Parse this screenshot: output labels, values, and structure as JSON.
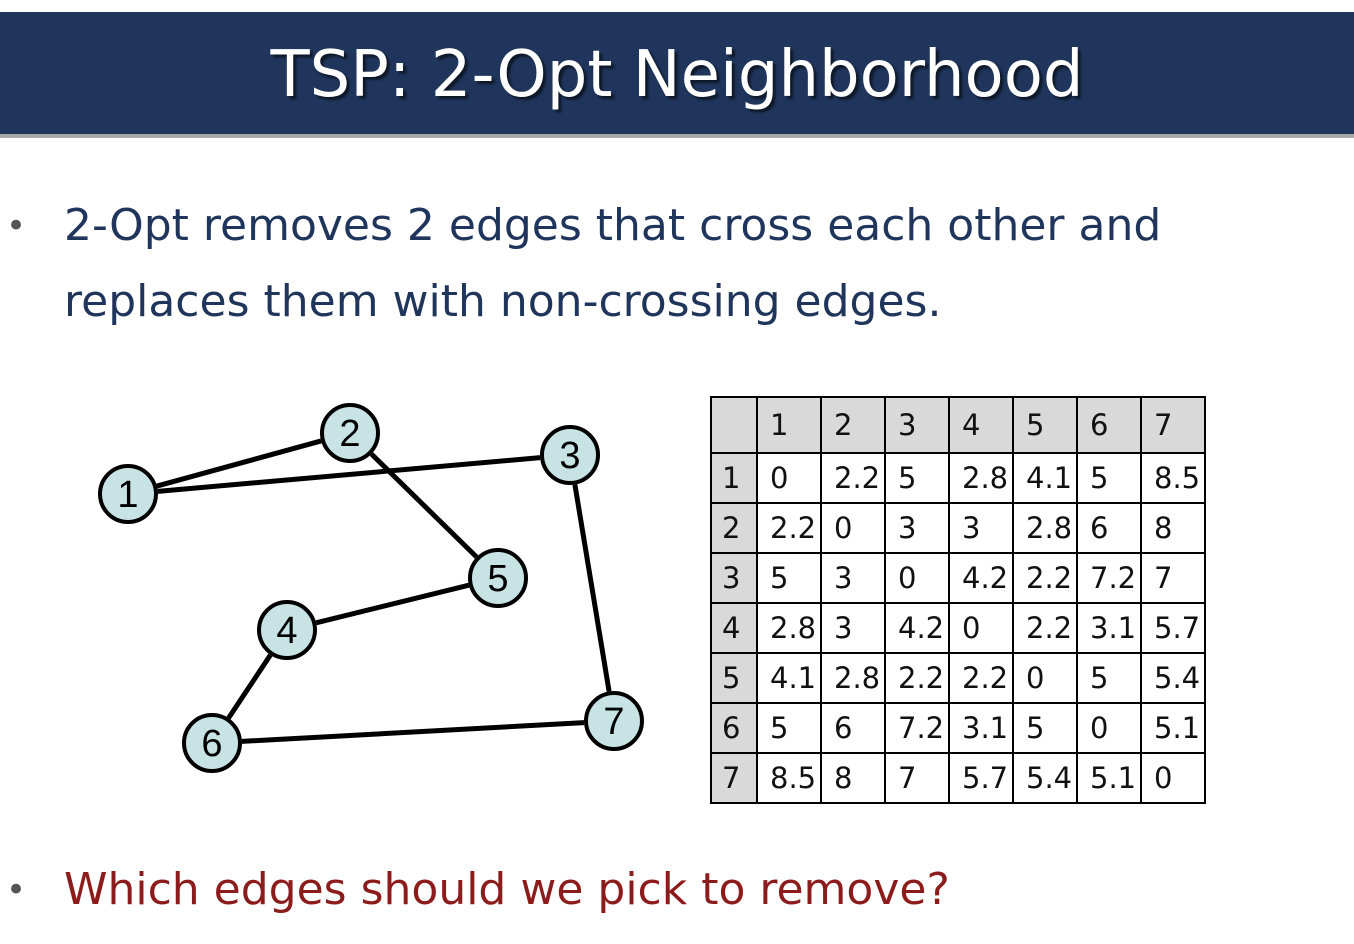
{
  "slide": {
    "title": "TSP: 2-Opt Neighborhood",
    "bullets": [
      {
        "symbol": "•",
        "lines": [
          "2-Opt removes 2 edges that cross each other and",
          "replaces them with non-crossing edges."
        ],
        "color": "#1f355b"
      },
      {
        "symbol": "•",
        "lines": [
          "Which edges should we pick to remove?"
        ],
        "color": "#8c1c1c"
      }
    ]
  },
  "graph": {
    "node_fill": "#c8e3e4",
    "nodes": [
      {
        "label": "1"
      },
      {
        "label": "2"
      },
      {
        "label": "3"
      },
      {
        "label": "4"
      },
      {
        "label": "5"
      },
      {
        "label": "6"
      },
      {
        "label": "7"
      }
    ],
    "edges": [
      [
        "1",
        "2"
      ],
      [
        "1",
        "3"
      ],
      [
        "2",
        "5"
      ],
      [
        "5",
        "4"
      ],
      [
        "4",
        "6"
      ],
      [
        "6",
        "7"
      ],
      [
        "3",
        "7"
      ]
    ]
  },
  "distance_table": {
    "columns": [
      "1",
      "2",
      "3",
      "4",
      "5",
      "6",
      "7"
    ],
    "rows": [
      {
        "label": "1",
        "values": [
          "0",
          "2.2",
          "5",
          "2.8",
          "4.1",
          "5",
          "8.5"
        ]
      },
      {
        "label": "2",
        "values": [
          "2.2",
          "0",
          "3",
          "3",
          "2.8",
          "6",
          "8"
        ]
      },
      {
        "label": "3",
        "values": [
          "5",
          "3",
          "0",
          "4.2",
          "2.2",
          "7.2",
          "7"
        ]
      },
      {
        "label": "4",
        "values": [
          "2.8",
          "3",
          "4.2",
          "0",
          "2.2",
          "3.1",
          "5.7"
        ]
      },
      {
        "label": "5",
        "values": [
          "4.1",
          "2.8",
          "2.2",
          "2.2",
          "0",
          "5",
          "5.4"
        ]
      },
      {
        "label": "6",
        "values": [
          "5",
          "6",
          "7.2",
          "3.1",
          "5",
          "0",
          "5.1"
        ]
      },
      {
        "label": "7",
        "values": [
          "8.5",
          "8",
          "7",
          "5.7",
          "5.4",
          "5.1",
          "0"
        ]
      }
    ]
  },
  "colors": {
    "title_bg": "#1f355b",
    "title_text": "#ffffff",
    "header_fill": "#d9d9d9"
  }
}
